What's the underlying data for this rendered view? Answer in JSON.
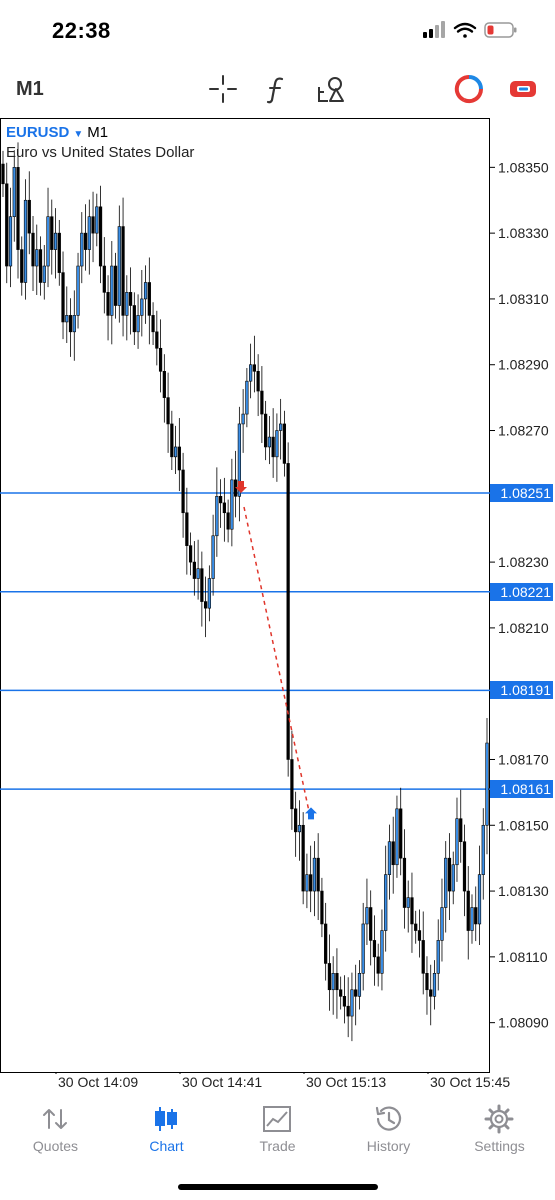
{
  "status": {
    "time": "22:38"
  },
  "toolbar": {
    "timeframe": "M1",
    "icons": [
      "crosshair-icon",
      "indicators-icon",
      "objects-icon",
      "accounts-icon",
      "trade-toggle-icon"
    ]
  },
  "chart": {
    "symbol": "EURUSD",
    "caret": "▼",
    "timeframe": "M1",
    "description": "Euro vs United States Dollar"
  },
  "chart_data": {
    "type": "candlestick",
    "price_axis": [
      "1.08350",
      "1.08330",
      "1.08310",
      "1.08290",
      "1.08270",
      "1.08230",
      "1.08210",
      "1.08170",
      "1.08150",
      "1.08130",
      "1.08110",
      "1.08090"
    ],
    "ylim": [
      1.08075,
      1.08365
    ],
    "horizontal_levels": [
      {
        "price": "1.08251",
        "value": 1.08251
      },
      {
        "price": "1.08221",
        "value": 1.08221
      },
      {
        "price": "1.08191",
        "value": 1.08191
      },
      {
        "price": "1.08161",
        "value": 1.08161
      }
    ],
    "time_labels": [
      "30 Oct 14:09",
      "30 Oct 14:41",
      "30 Oct 15:13",
      "30 Oct 15:45"
    ],
    "trade_markers": [
      {
        "type": "sell",
        "value": 1.08251,
        "color": "#e0352b"
      },
      {
        "type": "buy",
        "value": 1.08153,
        "color": "#1a73e8"
      }
    ],
    "closes": [
      1.08345,
      1.0832,
      1.08335,
      1.0835,
      1.08325,
      1.08315,
      1.0834,
      1.0833,
      1.0832,
      1.08325,
      1.08315,
      1.0832,
      1.08335,
      1.08325,
      1.0833,
      1.08318,
      1.08303,
      1.08305,
      1.083,
      1.08305,
      1.0832,
      1.0833,
      1.08325,
      1.08335,
      1.0833,
      1.08338,
      1.0832,
      1.08312,
      1.08305,
      1.0832,
      1.08308,
      1.08332,
      1.08305,
      1.08312,
      1.08308,
      1.083,
      1.08305,
      1.0831,
      1.08315,
      1.08305,
      1.083,
      1.08295,
      1.08288,
      1.0828,
      1.08272,
      1.08262,
      1.08265,
      1.08258,
      1.08245,
      1.08235,
      1.0823,
      1.08225,
      1.08228,
      1.08218,
      1.08216,
      1.08225,
      1.08238,
      1.0825,
      1.08248,
      1.08245,
      1.0824,
      1.08255,
      1.0825,
      1.08272,
      1.08275,
      1.08285,
      1.0829,
      1.08288,
      1.08282,
      1.08275,
      1.08265,
      1.08268,
      1.08262,
      1.0827,
      1.08272,
      1.0826,
      1.0817,
      1.08155,
      1.08148,
      1.0815,
      1.0813,
      1.08135,
      1.0813,
      1.0814,
      1.0813,
      1.0812,
      1.08108,
      1.081,
      1.08105,
      1.081,
      1.08098,
      1.08095,
      1.08092,
      1.081,
      1.08098,
      1.08105,
      1.0812,
      1.08125,
      1.08115,
      1.0811,
      1.08105,
      1.08118,
      1.08135,
      1.08145,
      1.08138,
      1.08155,
      1.0814,
      1.08125,
      1.08128,
      1.0812,
      1.08118,
      1.08115,
      1.08105,
      1.081,
      1.08098,
      1.08105,
      1.08115,
      1.08125,
      1.0814,
      1.0813,
      1.08138,
      1.08152,
      1.08145,
      1.0813,
      1.08118,
      1.08125,
      1.0812,
      1.08135,
      1.0815,
      1.08175
    ]
  },
  "tabs": [
    {
      "label": "Quotes",
      "icon": "quotes-icon"
    },
    {
      "label": "Chart",
      "icon": "chart-icon"
    },
    {
      "label": "Trade",
      "icon": "trade-icon"
    },
    {
      "label": "History",
      "icon": "history-icon"
    },
    {
      "label": "Settings",
      "icon": "settings-icon"
    }
  ],
  "colors": {
    "accent": "#1a73e8",
    "sell": "#e0352b",
    "bull_candle": "#3a8ee6",
    "bear_candle": "#000000"
  }
}
